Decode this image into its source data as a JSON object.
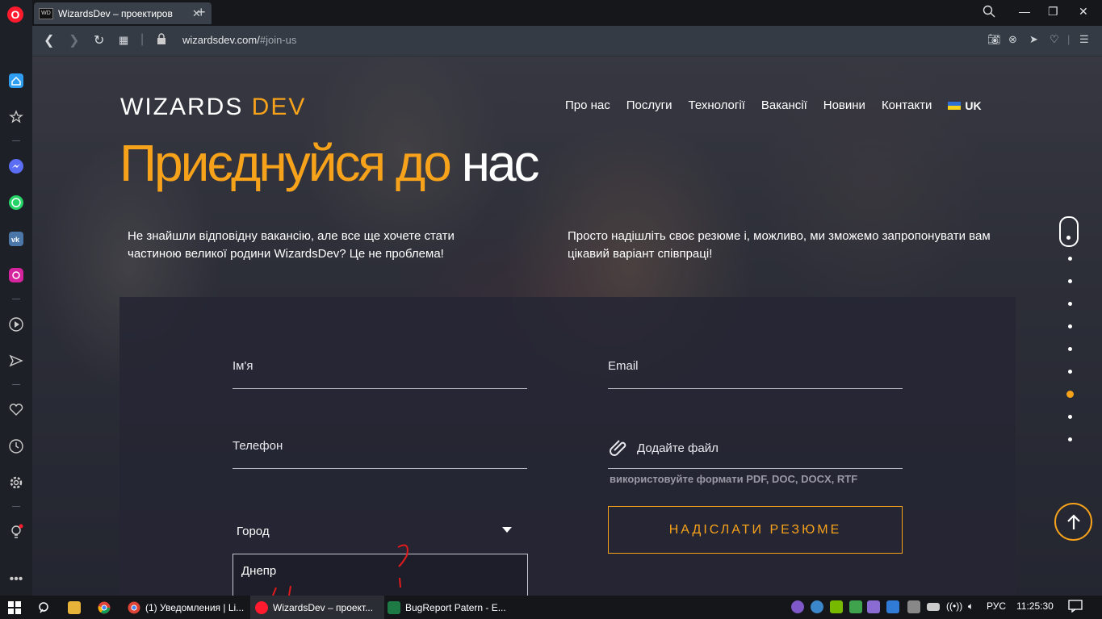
{
  "browser": {
    "tab_title": "WizardsDev – проектиров",
    "tab_favicon": "WD",
    "url_host": "wizardsdev.com/",
    "url_path": "#join-us"
  },
  "site": {
    "logo_main": "WIZARDS ",
    "logo_accent": "DEV",
    "nav": [
      "Про нас",
      "Послуги",
      "Технології",
      "Вакансії",
      "Новини",
      "Контакти"
    ],
    "lang": "UK"
  },
  "hero": {
    "headline_accent": "Приєднуйся до",
    "headline_rest": " нас",
    "intro_left": "Не знайшли відповідну вакансію, але все ще хочете стати частиною великої родини WizardsDev? Це не проблема!",
    "intro_right": "Просто надішліть своє резюме і, можливо, ми зможемо запропонувати вам цікавий варіант співпраці!"
  },
  "form": {
    "name_label": "Ім'я",
    "email_label": "Email",
    "phone_label": "Телефон",
    "file_label": "Додайте файл",
    "file_hint": "використовуйте формати PDF, DOC, DOCX, RTF",
    "city_label": "Город",
    "city_option": "Днепр",
    "submit_label": "НАДІСЛАТИ РЕЗЮМЕ"
  },
  "taskbar": {
    "items": [
      "(1) Уведомления | Li...",
      "WizardsDev – проект...",
      "BugReport Patern - E..."
    ],
    "lang": "РУС",
    "time": "11:25:30"
  },
  "colors": {
    "accent": "#f7a21b",
    "opera_red": "#ff1b2d"
  }
}
